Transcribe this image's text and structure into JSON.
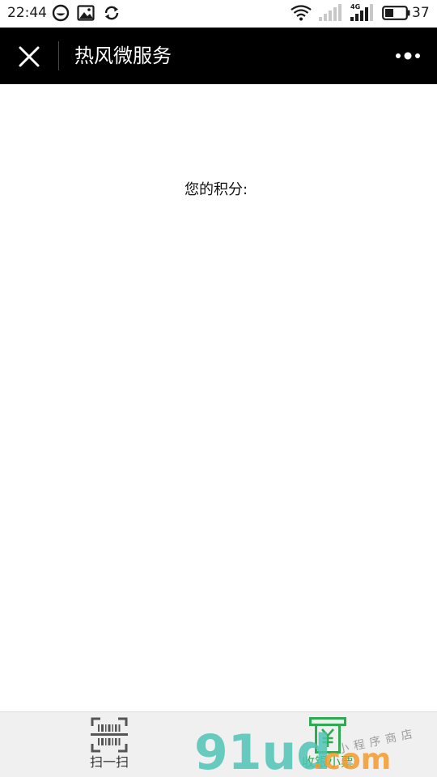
{
  "status_bar": {
    "time": "22:44",
    "battery_level": "37",
    "icons": [
      "chat-bubble-icon",
      "image-icon",
      "sync-icon",
      "wifi-icon",
      "signal-icon",
      "signal-4g-icon",
      "battery-icon"
    ],
    "network_label": "4G"
  },
  "header": {
    "title": "热风微服务",
    "close_icon": "close-icon",
    "more_icon": "more-icon"
  },
  "main": {
    "points_label": "您的积分:"
  },
  "tabs": [
    {
      "label": "扫一扫",
      "icon": "barcode-scan-icon"
    },
    {
      "label": "收银小票",
      "icon": "receipt-icon"
    }
  ],
  "watermark": {
    "brand": "91ud.com",
    "tagline": "小程序商店"
  },
  "colors": {
    "title_bar": "#000000",
    "accent_green": "#2eaa52",
    "watermark_teal": "#4fc3b5",
    "watermark_orange": "#f39a2b"
  }
}
